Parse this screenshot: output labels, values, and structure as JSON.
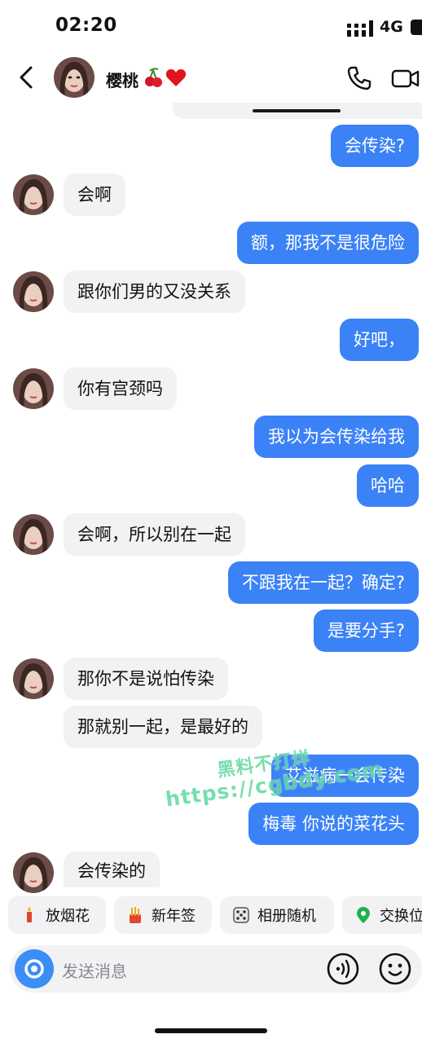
{
  "status_bar": {
    "time": "02:20",
    "network": "4G"
  },
  "header": {
    "contact_name": "樱桃",
    "name_emoji": "cherries-heart-emoji"
  },
  "messages": [
    {
      "side": "out",
      "text": "会传染?"
    },
    {
      "side": "in",
      "text": "会啊"
    },
    {
      "side": "out",
      "text": "额，那我不是很危险"
    },
    {
      "side": "in",
      "text": "跟你们男的又没关系"
    },
    {
      "side": "out",
      "text": "好吧，"
    },
    {
      "side": "in",
      "text": "你有宫颈吗"
    },
    {
      "side": "out",
      "text": "我以为会传染给我"
    },
    {
      "side": "out",
      "text": "哈哈"
    },
    {
      "side": "in",
      "text": "会啊，所以别在一起"
    },
    {
      "side": "out",
      "text": "不跟我在一起？确定?"
    },
    {
      "side": "out",
      "text": "是要分手?"
    },
    {
      "side": "in",
      "text": "那你不是说怕传染"
    },
    {
      "side": "in",
      "text": "那就别一起，是最好的"
    },
    {
      "side": "out",
      "text": "艾滋病一会传染"
    },
    {
      "side": "out",
      "text": "梅毒 你说的菜花头"
    },
    {
      "side": "in",
      "text": "会传染的"
    }
  ],
  "watermark": {
    "line1": "黑料不打烊",
    "line2": "https://cgbdy.com"
  },
  "quick_actions": [
    {
      "label": "放烟花",
      "icon": "firework-icon"
    },
    {
      "label": "新年签",
      "icon": "fortune-stick-icon"
    },
    {
      "label": "相册随机",
      "icon": "dice-icon"
    },
    {
      "label": "交换位",
      "icon": "location-pin-icon"
    }
  ],
  "input": {
    "placeholder": "发送消息"
  },
  "colors": {
    "accent": "#3b82f6",
    "incoming_bubble": "#f2f2f4",
    "camera_button": "#3b8ef5",
    "watermark": "#5fd9a0"
  }
}
